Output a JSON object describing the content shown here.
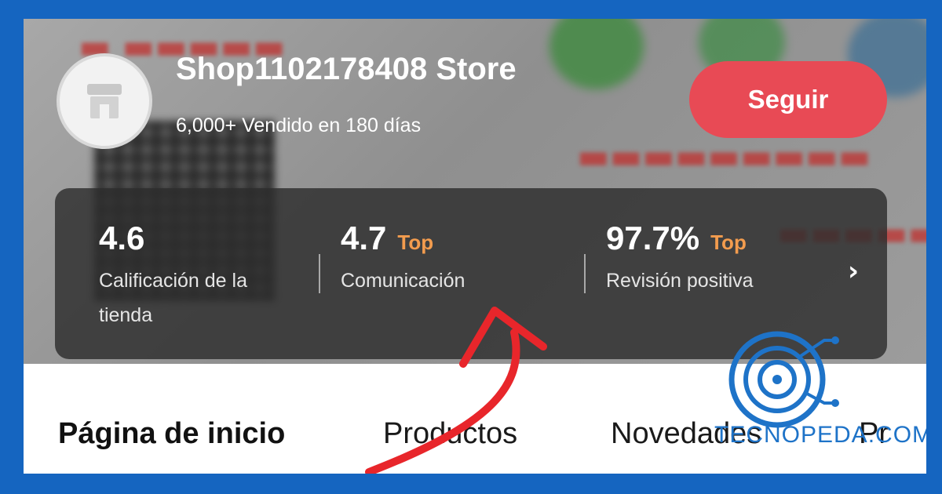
{
  "store": {
    "name": "Shop1102178408 Store",
    "sold": "6,000+ Vendido en 180 días",
    "follow_label": "Seguir"
  },
  "stats": [
    {
      "value": "4.6",
      "badge": "",
      "label": "Calificación de la tienda"
    },
    {
      "value": "4.7",
      "badge": "Top",
      "label": "Comunicación"
    },
    {
      "value": "97.7",
      "unit": "%",
      "badge": "Top",
      "label": "Revisión positiva"
    }
  ],
  "tabs": [
    {
      "label": "Página de inicio",
      "active": true
    },
    {
      "label": "Productos",
      "active": false
    },
    {
      "label": "Novedades",
      "active": false
    },
    {
      "label": "Pr",
      "active": false
    }
  ],
  "watermark": {
    "text": "TECNOPEDA.COM"
  },
  "icons": {
    "avatar": "store-icon",
    "more": "chevron-right-icon"
  },
  "colors": {
    "follow": "#e84a55",
    "badge": "#f39c4e",
    "frame": "#1565c0",
    "arrow": "#e8262b"
  }
}
